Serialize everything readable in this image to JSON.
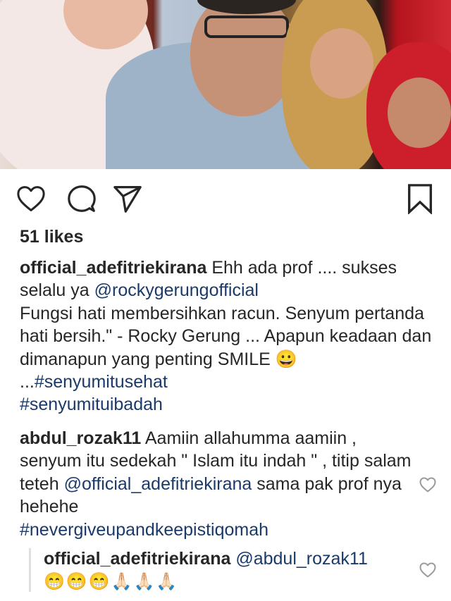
{
  "post": {
    "likes_text": "51 likes",
    "caption": {
      "username": "official_adefitriekirana",
      "text_1": " Ehh ada prof .... sukses selalu ya ",
      "mention": "@rockygerungofficial",
      "text_2": "Fungsi hati membersihkan racun. Senyum pertanda hati bersih.\" - Rocky Gerung ... Apapun keadaan dan dimanapun yang penting SMILE ",
      "emoji": "😀",
      "text_3": " ...",
      "hashtag_1": "#senyumitusehat",
      "hashtag_2": "#senyumituibadah"
    }
  },
  "comments": [
    {
      "username": "abdul_rozak11",
      "text_1": " Aamiin allahumma aamiin , senyum itu sedekah \" Islam itu indah \" , titip salam teteh ",
      "mention": "@official_adefitriekirana",
      "text_2": " sama pak prof nya hehehe",
      "hashtag": "#nevergiveupandkeepistiqomah"
    }
  ],
  "replies": [
    {
      "username": "official_adefitriekirana",
      "mention": " @abdul_rozak11",
      "emojis": "😁😁😁🙏🏻🙏🏻🙏🏻"
    }
  ],
  "icons": {
    "like": "heart-outline",
    "comment": "speech-bubble",
    "share": "paper-plane",
    "save": "bookmark"
  }
}
